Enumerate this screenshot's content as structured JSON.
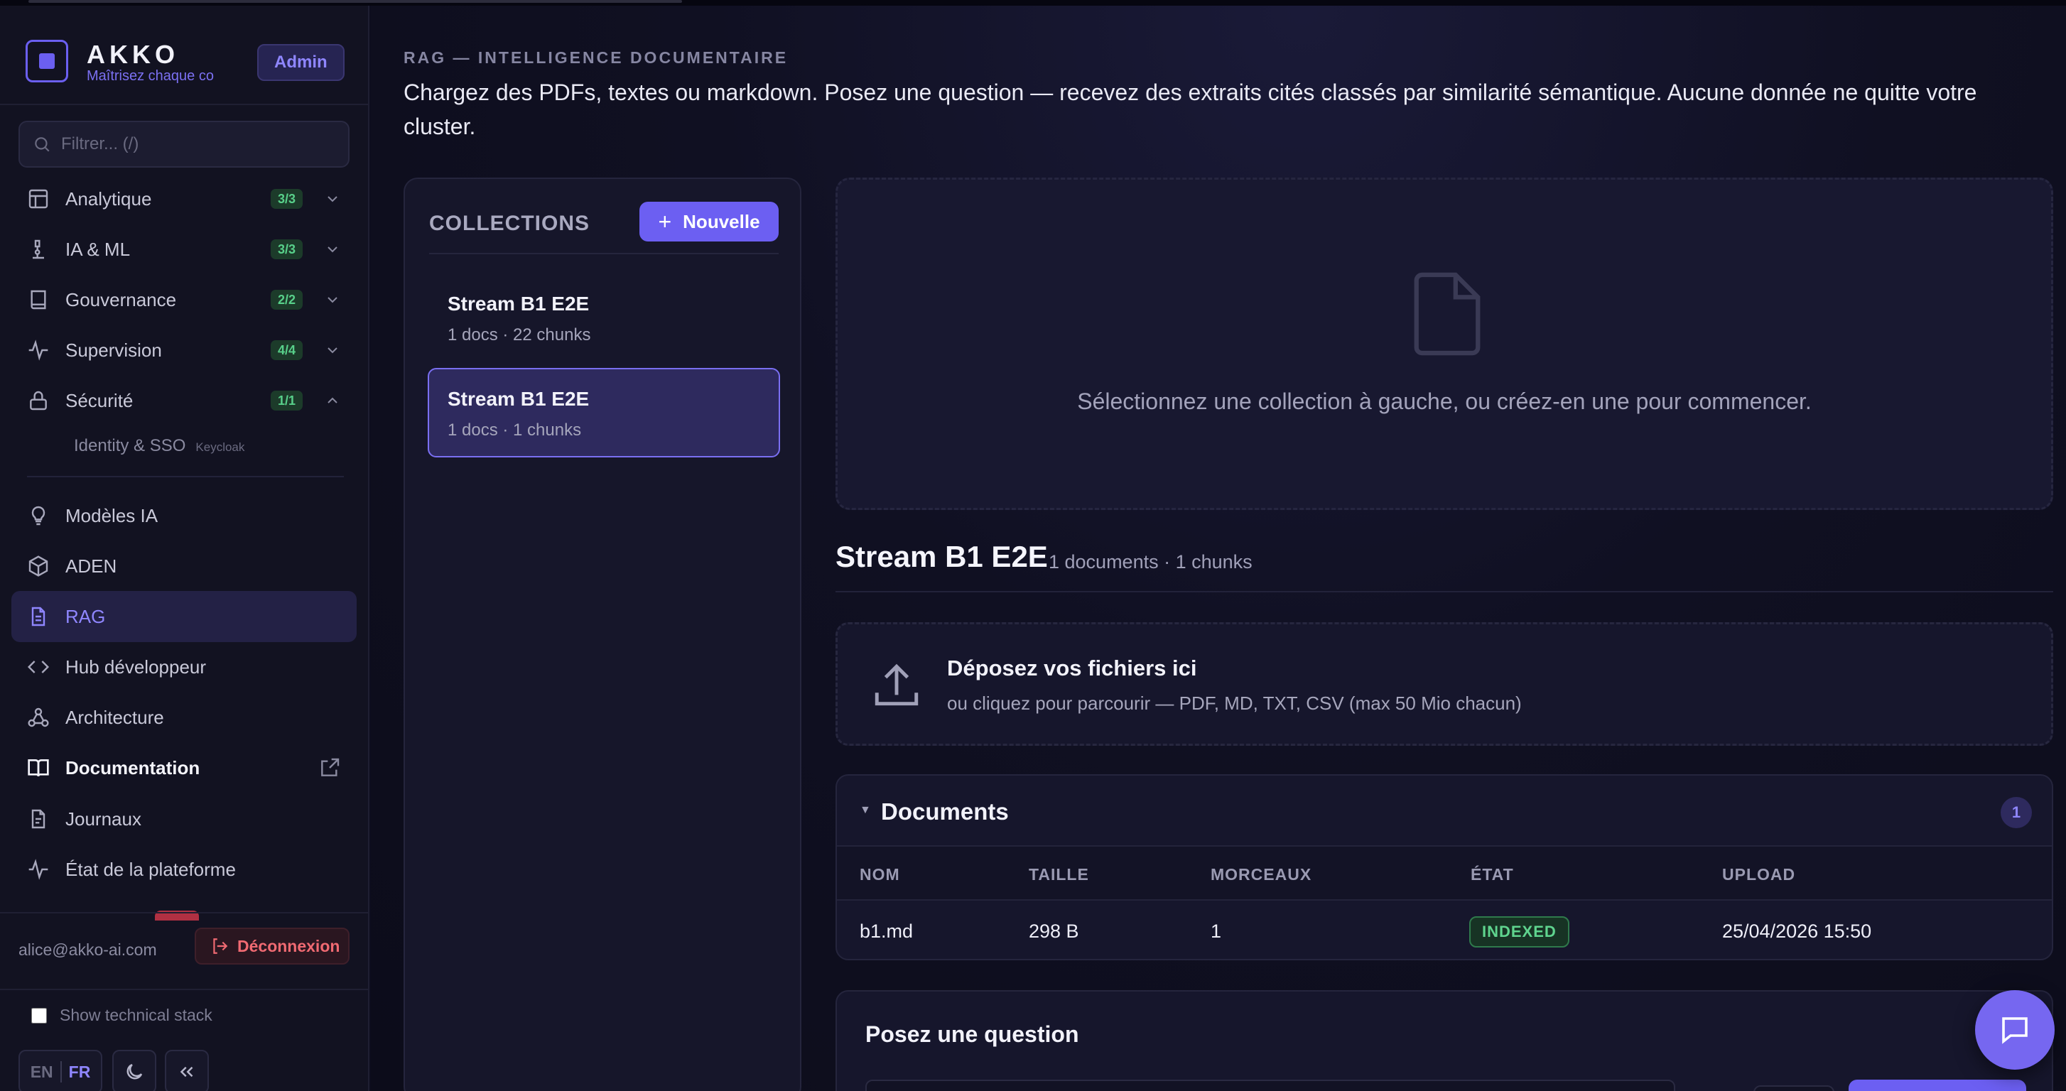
{
  "sidebar": {
    "brand": {
      "name": "AKKO",
      "tagline": "Maîtrisez chaque co",
      "badge": "Admin"
    },
    "filter": {
      "placeholder": "Filtrer... (/)",
      "value": ""
    },
    "groups": [
      {
        "label": "Analytique",
        "count": "3/3",
        "icon": "layout-icon"
      },
      {
        "label": "IA & ML",
        "count": "3/3",
        "icon": "microscope-icon"
      },
      {
        "label": "Gouvernance",
        "count": "2/2",
        "icon": "book-icon"
      },
      {
        "label": "Supervision",
        "count": "4/4",
        "icon": "activity-icon"
      },
      {
        "label": "Sécurité",
        "count": "1/1",
        "icon": "lock-icon"
      }
    ],
    "security_sub": {
      "label": "Identity & SSO",
      "tag": "Keycloak"
    },
    "items": [
      {
        "label": "Modèles IA",
        "icon": "lightbulb-icon"
      },
      {
        "label": "ADEN",
        "icon": "cube-icon"
      },
      {
        "label": "RAG",
        "icon": "file-text-icon"
      },
      {
        "label": "Hub développeur",
        "icon": "code-icon"
      },
      {
        "label": "Architecture",
        "icon": "network-icon"
      },
      {
        "label": "Documentation",
        "icon": "open-book-icon"
      },
      {
        "label": "Journaux",
        "icon": "file-lines-icon"
      },
      {
        "label": "État de la plateforme",
        "icon": "pulse-icon"
      }
    ],
    "user_email": "alice@akko-ai.com",
    "logout_label": "Déconnexion",
    "tech_stack_label": "Show technical stack",
    "lang": {
      "en": "EN",
      "fr": "FR"
    }
  },
  "page": {
    "kicker": "RAG — INTELLIGENCE DOCUMENTAIRE",
    "description": "Chargez des PDFs, textes ou markdown. Posez une question — recevez des extraits cités classés par similarité sémantique. Aucune donnée ne quitte votre cluster."
  },
  "collections": {
    "title": "COLLECTIONS",
    "new_button": "Nouvelle",
    "items": [
      {
        "name": "Stream B1 E2E",
        "meta": "1 docs · 22 chunks"
      },
      {
        "name": "Stream B1 E2E",
        "meta": "1 docs · 1 chunks"
      }
    ]
  },
  "empty_state": {
    "text": "Sélectionnez une collection à gauche, ou créez-en une pour commencer."
  },
  "detail": {
    "title": "Stream B1 E2E",
    "meta": "1 documents · 1 chunks",
    "dropzone": {
      "title": "Déposez vos fichiers ici",
      "subtitle": "ou cliquez pour parcourir — PDF, MD, TXT, CSV (max 50 Mio chacun)"
    },
    "documents": {
      "title": "Documents",
      "count": "1",
      "columns": [
        "NOM",
        "TAILLE",
        "MORCEAUX",
        "ÉTAT",
        "UPLOAD"
      ],
      "rows": [
        {
          "name": "b1.md",
          "size": "298 B",
          "chunks": "1",
          "state": "INDEXED",
          "upload": "25/04/2026 15:50"
        }
      ]
    },
    "ask": {
      "title": "Posez une question"
    }
  },
  "colors": {
    "accent": "#6c5ff2",
    "success": "#5fd48e",
    "danger": "#f06a72",
    "background": "#0d0d1e"
  }
}
